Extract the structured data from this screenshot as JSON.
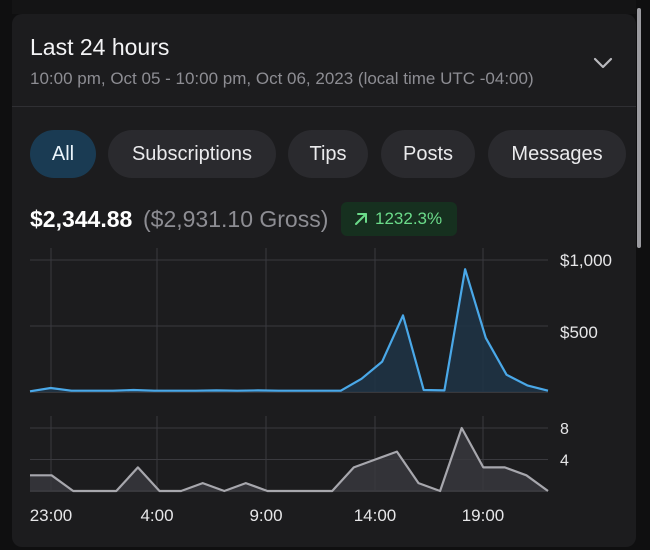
{
  "header": {
    "title": "Last 24 hours",
    "subtitle": "10:00 pm, Oct 05 - 10:00 pm, Oct 06, 2023 (local time UTC -04:00)"
  },
  "filters": {
    "chips": [
      "All",
      "Subscriptions",
      "Tips",
      "Posts",
      "Messages"
    ],
    "active": "All"
  },
  "summary": {
    "net": "$2,344.88",
    "gross": "($2,931.10 Gross)",
    "change": "1232.3%"
  },
  "colors": {
    "accent": "#4aa8e8",
    "secondary": "#a7a7ad",
    "positive": "#6bdb8a",
    "chip_active": "#1a3b53"
  },
  "chart_data": [
    {
      "type": "area",
      "x": [
        0,
        1,
        2,
        3,
        4,
        5,
        6,
        7,
        8,
        9,
        10,
        11,
        12,
        13,
        14,
        15,
        16,
        17,
        18,
        19,
        20,
        21,
        22,
        23,
        24
      ],
      "values": [
        5,
        30,
        10,
        10,
        10,
        15,
        10,
        10,
        10,
        12,
        10,
        12,
        10,
        10,
        10,
        10,
        100,
        230,
        580,
        15,
        12,
        930,
        410,
        130,
        50,
        10
      ],
      "ylim": [
        0,
        1000
      ],
      "ytick_labels": [
        "$500",
        "$1,000"
      ]
    },
    {
      "type": "area",
      "values": [
        2,
        2,
        0,
        0,
        0,
        3,
        0,
        0,
        1,
        0,
        1,
        0,
        0,
        0,
        0,
        3,
        4,
        5,
        1,
        0,
        8,
        3,
        3,
        2,
        0
      ],
      "ylim": [
        0,
        8
      ],
      "ytick_labels": [
        "4",
        "8"
      ],
      "xtick_labels": [
        "23:00",
        "4:00",
        "9:00",
        "14:00",
        "19:00"
      ]
    }
  ]
}
